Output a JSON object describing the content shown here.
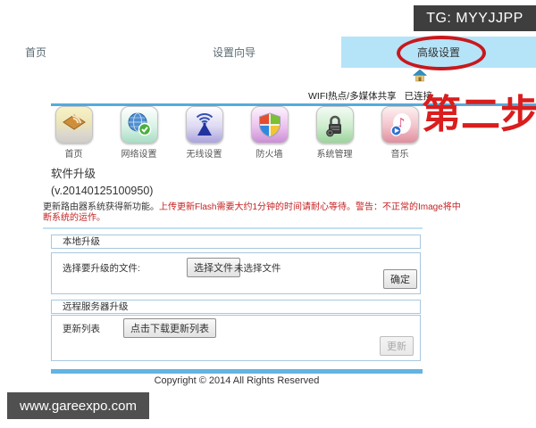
{
  "watermarks": {
    "tg_badge": "TG: MYYJJPP",
    "site": "www.gareexpo.com"
  },
  "annotations": {
    "step_label": "第二步"
  },
  "tabs": [
    {
      "label": "首页"
    },
    {
      "label": "设置向导"
    },
    {
      "label": "高级设置",
      "active": true
    }
  ],
  "status_bar": {
    "wifi_label": "WIFI热点/多媒体共享",
    "status": "已连接"
  },
  "nav_icons": [
    {
      "label": "首页",
      "icon": "home-icon"
    },
    {
      "label": "网络设置",
      "icon": "globe-check-icon"
    },
    {
      "label": "无线设置",
      "icon": "antenna-icon"
    },
    {
      "label": "防火墙",
      "icon": "shield-icon"
    },
    {
      "label": "系统管理",
      "icon": "lock-gear-icon"
    },
    {
      "label": "音乐",
      "icon": "music-note-icon"
    }
  ],
  "page": {
    "title": "软件升级",
    "version": "(v.20140125100950)",
    "notice_normal": "更新路由器系统获得新功能。",
    "notice_warning": "上传更新Flash需要大约1分钟的时间请耐心等待。警告：不正常的Image将中断系统的运作。"
  },
  "local_upgrade": {
    "header": "本地升级",
    "file_label": "选择要升级的文件:",
    "choose_button": "选择文件",
    "no_file_text": "未选择文件",
    "ok_button": "确定"
  },
  "remote_upgrade": {
    "header": "远程服务器升级",
    "list_label": "更新列表",
    "download_button": "点击下载更新列表",
    "update_button": "更新"
  },
  "footer": {
    "copyright": "Copyright © 2014 All Rights Reserved"
  },
  "colors": {
    "accent_blue": "#56abdb",
    "tab_active_bg": "#b5e4f8",
    "annotation_red": "#c9181c",
    "step_red": "#da1d1d",
    "warning_red": "#c42222",
    "box_border": "#a9c7de"
  }
}
